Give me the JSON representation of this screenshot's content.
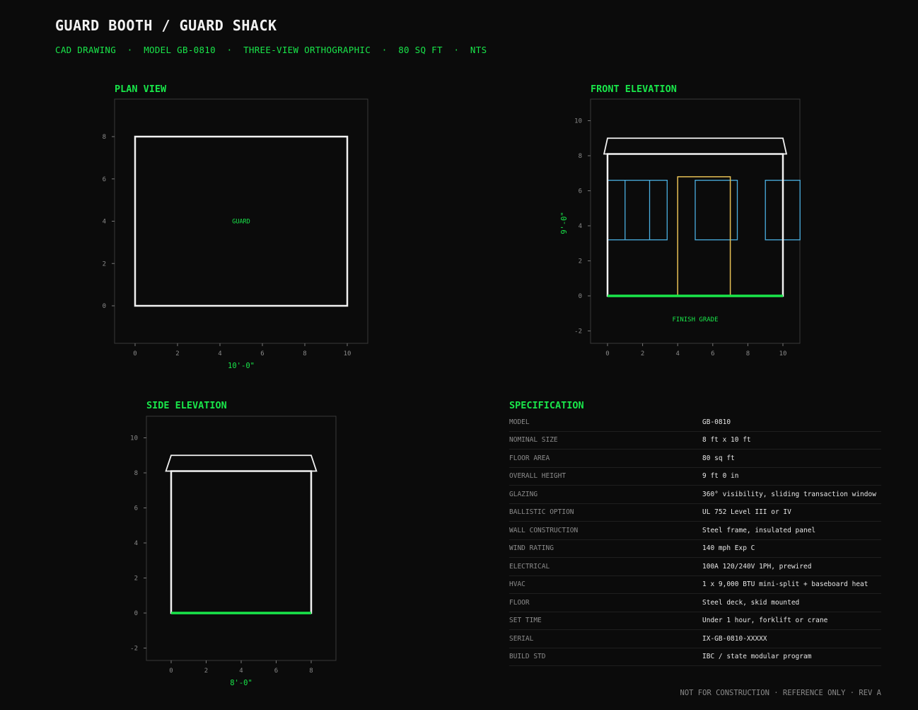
{
  "header": {
    "title": "GUARD BOOTH / GUARD SHACK",
    "subtitle": "CAD DRAWING  ·  MODEL GB-0810  ·  THREE-VIEW ORTHOGRAPHIC  ·  80 SQ FT  ·  NTS"
  },
  "plan": {
    "title": "PLAN VIEW",
    "label": "GUARD",
    "x_dim": "10'-0\"",
    "x_ticks": [
      0,
      2,
      4,
      6,
      8,
      10
    ],
    "y_ticks": [
      0,
      2,
      4,
      6,
      8
    ]
  },
  "front": {
    "title": "FRONT ELEVATION",
    "y_dim": "9'-0\"",
    "grade_label": "FINISH GRADE",
    "x_ticks": [
      0,
      2,
      4,
      6,
      8,
      10
    ],
    "y_ticks": [
      -2,
      0,
      2,
      4,
      6,
      8,
      10
    ]
  },
  "side": {
    "title": "SIDE ELEVATION",
    "x_dim": "8'-0\"",
    "x_ticks": [
      0,
      2,
      4,
      6,
      8
    ],
    "y_ticks": [
      -2,
      0,
      2,
      4,
      6,
      8,
      10
    ]
  },
  "spec": {
    "title": "SPECIFICATION",
    "rows": [
      {
        "key": "MODEL",
        "value": "GB-0810"
      },
      {
        "key": "NOMINAL SIZE",
        "value": "8 ft x 10 ft"
      },
      {
        "key": "FLOOR AREA",
        "value": "80 sq ft"
      },
      {
        "key": "OVERALL HEIGHT",
        "value": "9 ft 0 in"
      },
      {
        "key": "GLAZING",
        "value": "360° visibility, sliding transaction window"
      },
      {
        "key": "BALLISTIC OPTION",
        "value": "UL 752 Level III or IV"
      },
      {
        "key": "WALL CONSTRUCTION",
        "value": "Steel frame, insulated panel"
      },
      {
        "key": "WIND RATING",
        "value": "140 mph Exp C"
      },
      {
        "key": "ELECTRICAL",
        "value": "100A 120/240V 1PH, prewired"
      },
      {
        "key": "HVAC",
        "value": "1 x 9,000 BTU mini-split + baseboard heat"
      },
      {
        "key": "FLOOR",
        "value": "Steel deck, skid mounted"
      },
      {
        "key": "SET TIME",
        "value": "Under 1 hour, forklift or crane"
      },
      {
        "key": "SERIAL",
        "value": "IX-GB-0810-XXXXX"
      },
      {
        "key": "BUILD STD",
        "value": "IBC / state modular program"
      }
    ]
  },
  "footer": "NOT FOR CONSTRUCTION · REFERENCE ONLY · REV A",
  "colors": {
    "background": "#0b0b0b",
    "accent_green": "#19e64a",
    "wall_white": "#f2f2f2",
    "window_blue": "#4aaee0",
    "door_yellow": "#e6c055"
  }
}
